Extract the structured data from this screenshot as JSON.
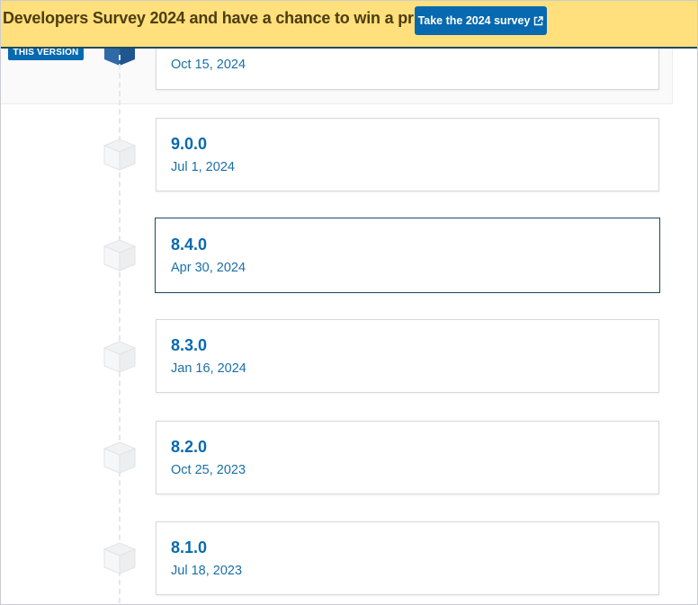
{
  "banner": {
    "text": "Developers Survey 2024 and have a chance to win a prize!",
    "button_label": "Take the 2024 survey",
    "bg_color": "#ffe07d",
    "button_color": "#0769b0"
  },
  "current": {
    "badge": "THIS VERSION",
    "date": "Oct 15, 2024"
  },
  "versions": [
    {
      "version": "9.0.0",
      "date": "Jul 1, 2024"
    },
    {
      "version": "8.4.0",
      "date": "Apr 30, 2024"
    },
    {
      "version": "8.3.0",
      "date": "Jan 16, 2024"
    },
    {
      "version": "8.2.0",
      "date": "Oct 25, 2023"
    },
    {
      "version": "8.1.0",
      "date": "Jul 18, 2023"
    }
  ],
  "icons": {
    "external": "external-link-icon",
    "cube": "package-cube-icon"
  }
}
